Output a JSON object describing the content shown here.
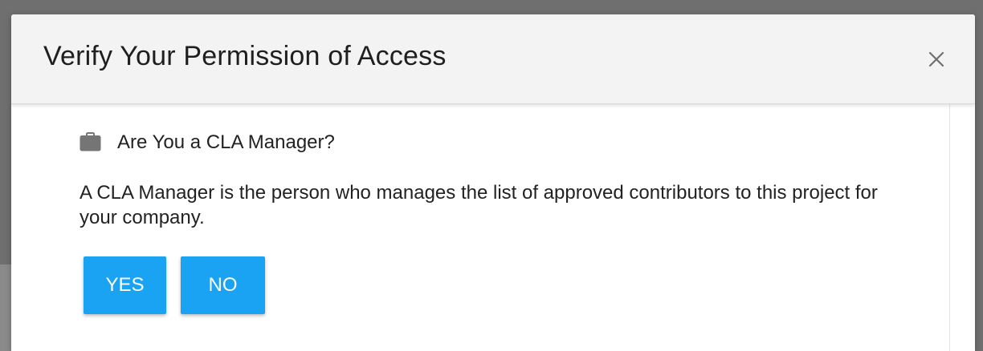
{
  "dialog": {
    "title": "Verify Your Permission of Access",
    "close_icon": "close-icon",
    "question": {
      "icon": "briefcase-icon",
      "text": "Are You a CLA Manager?"
    },
    "description": "A CLA Manager is the person who manages the list of approved contributors to this project for your company.",
    "buttons": {
      "yes_label": "YES",
      "no_label": "NO"
    }
  },
  "colors": {
    "button_bg": "#1aa3f2",
    "header_bg": "#f3f3f3",
    "backdrop": "#6f6f6f",
    "icon_gray": "#757575"
  }
}
